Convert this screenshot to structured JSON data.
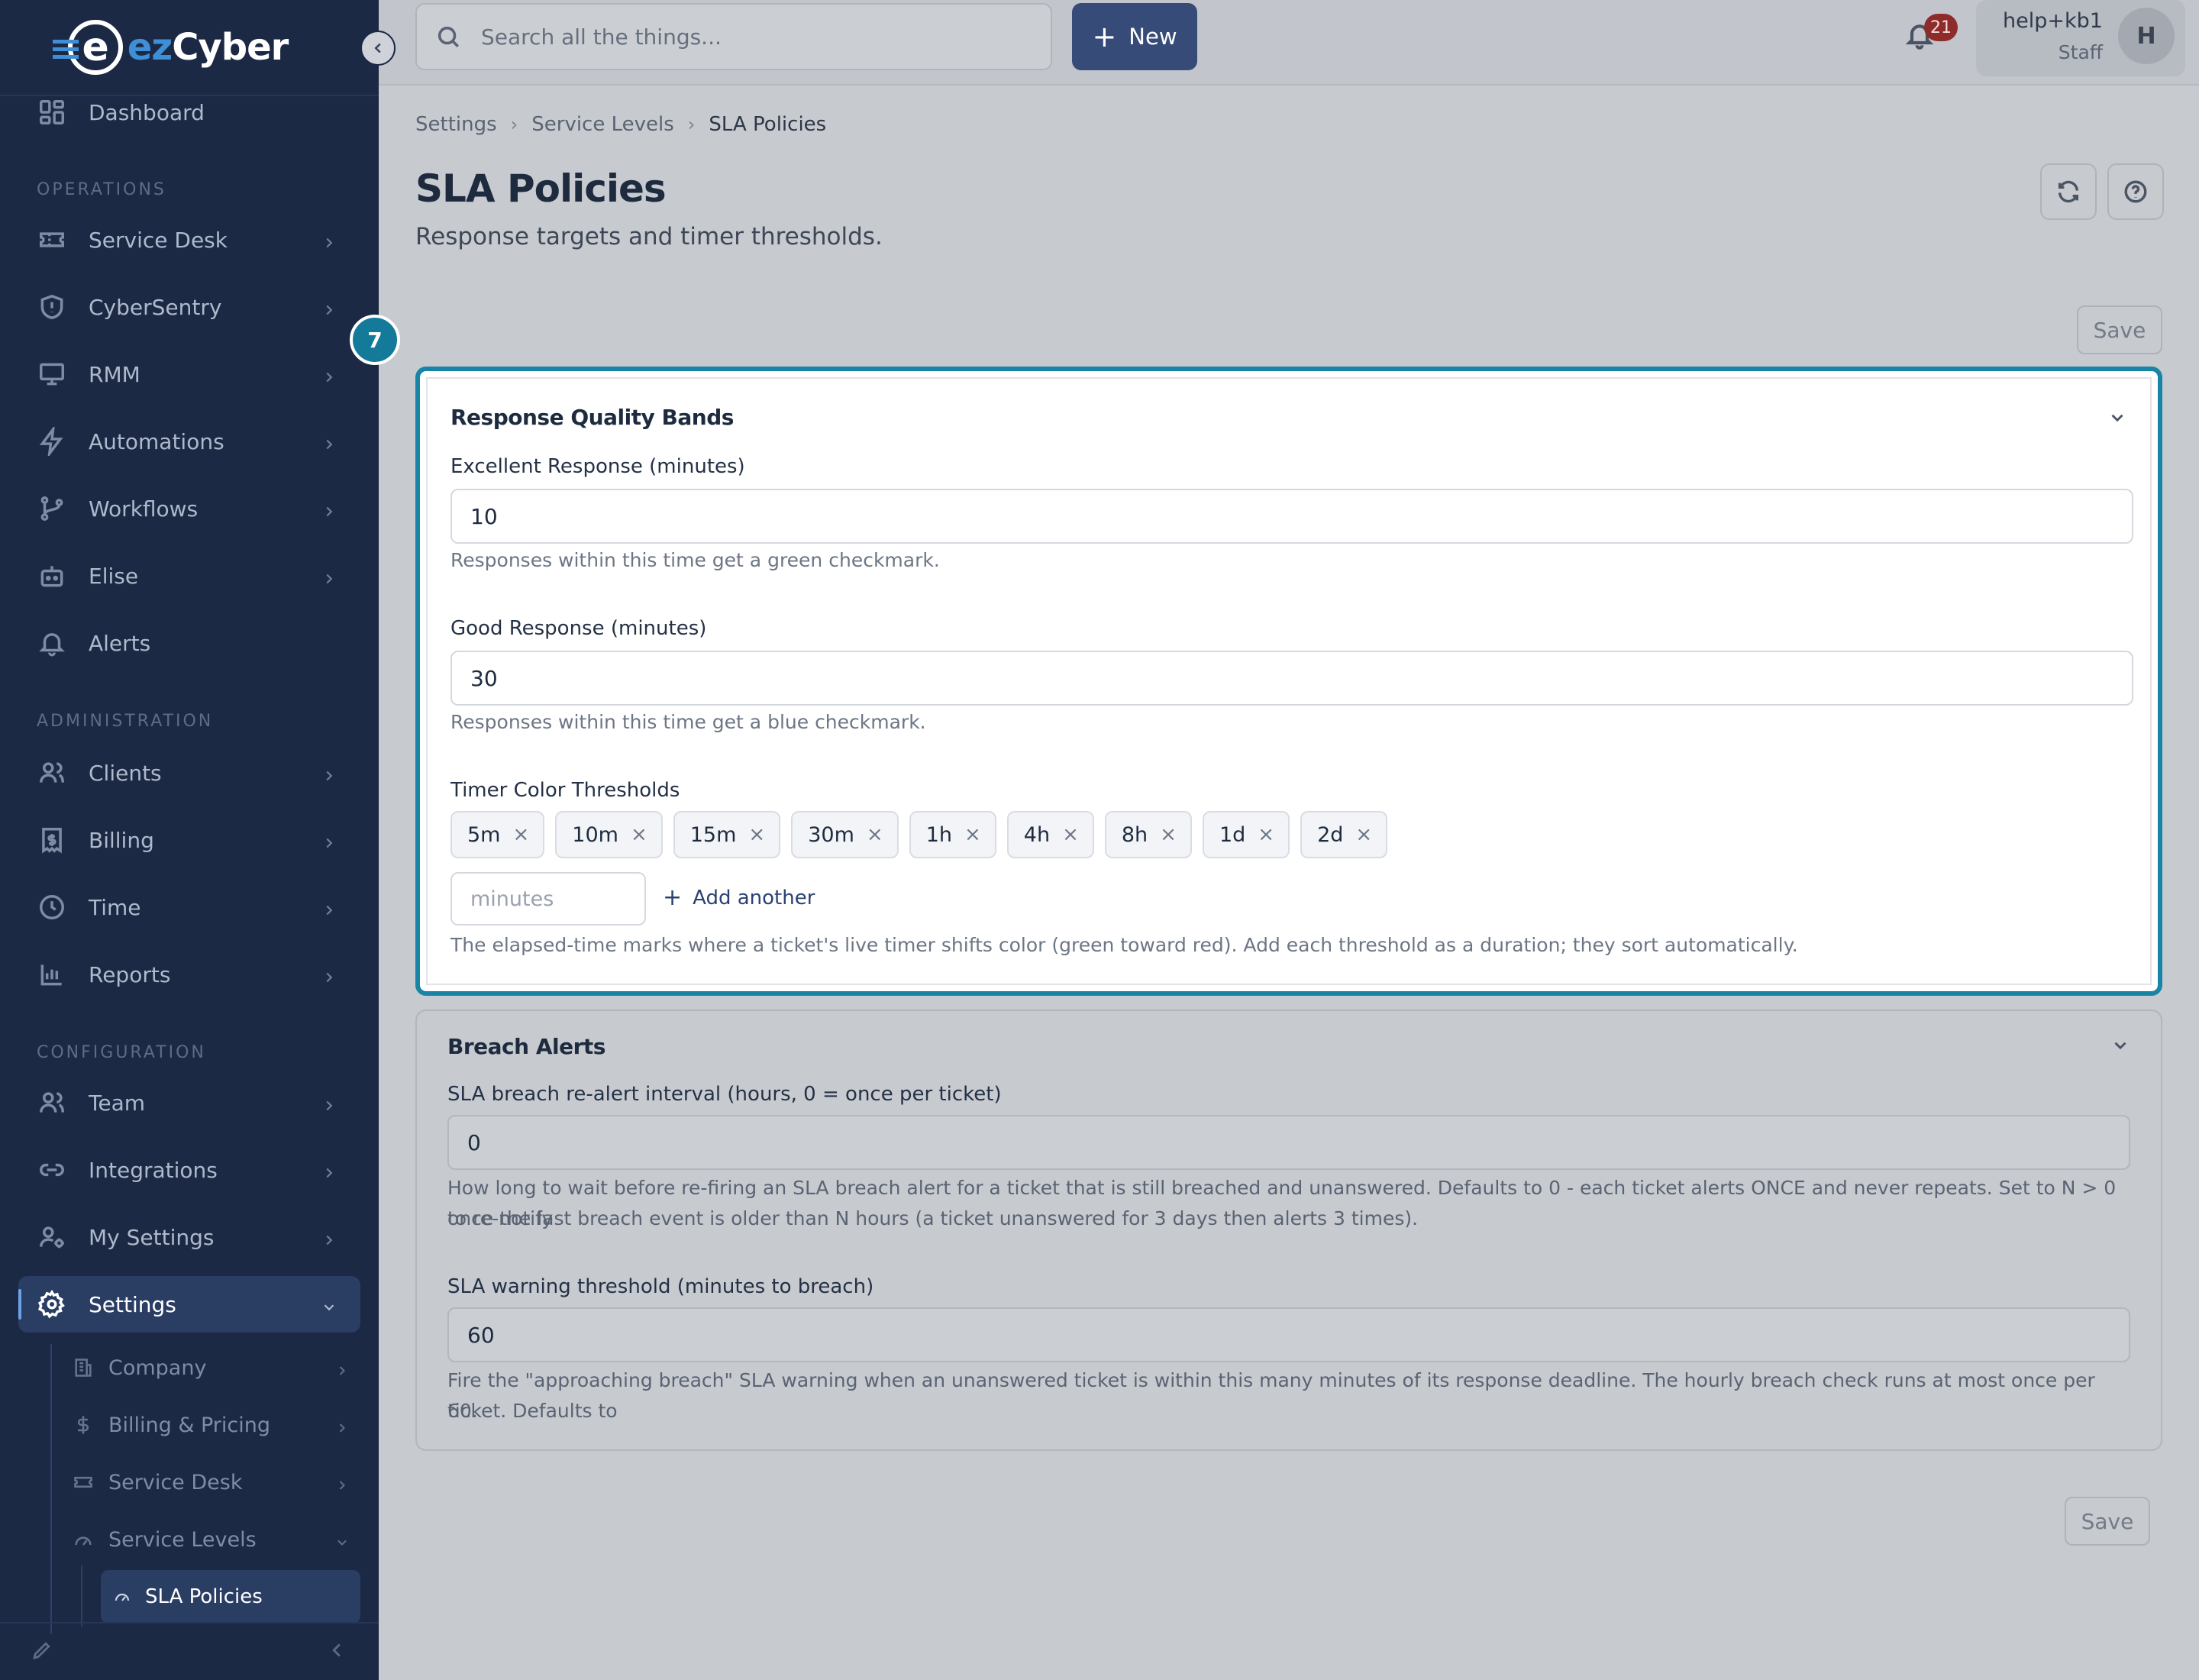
{
  "brand": {
    "logo_prefix": "ez",
    "logo_text": "Cyber",
    "logo_mark": "e"
  },
  "sidebar": {
    "dashboard": "Dashboard",
    "sections": {
      "operations": "OPERATIONS",
      "administration": "ADMINISTRATION",
      "configuration": "CONFIGURATION"
    },
    "operations": [
      "Service Desk",
      "CyberSentry",
      "RMM",
      "Automations",
      "Workflows",
      "Elise",
      "Alerts"
    ],
    "administration": [
      "Clients",
      "Billing",
      "Time",
      "Reports"
    ],
    "configuration": [
      "Team",
      "Integrations",
      "My Settings",
      "Settings"
    ],
    "settings_children": [
      "Company",
      "Billing & Pricing",
      "Service Desk",
      "Service Levels"
    ],
    "active_leaf": "SLA Policies"
  },
  "topbar": {
    "search_placeholder": "Search all the things...",
    "new_label": "New",
    "notification_count": "21",
    "user_name": "help+kb1",
    "user_role": "Staff",
    "avatar_initial": "H"
  },
  "breadcrumb": [
    "Settings",
    "Service Levels",
    "SLA Policies"
  ],
  "page": {
    "title": "SLA Policies",
    "subtitle": "Response targets and timer thresholds.",
    "save_label": "Save",
    "step_number": "7"
  },
  "quality_bands": {
    "title": "Response Quality Bands",
    "excellent": {
      "label": "Excellent Response (minutes)",
      "value": "10",
      "help": "Responses within this time get a green checkmark."
    },
    "good": {
      "label": "Good Response (minutes)",
      "value": "30",
      "help": "Responses within this time get a blue checkmark."
    },
    "thresholds": {
      "label": "Timer Color Thresholds",
      "chips": [
        "5m",
        "10m",
        "15m",
        "30m",
        "1h",
        "4h",
        "8h",
        "1d",
        "2d"
      ],
      "input_placeholder": "minutes",
      "add_label": "Add another",
      "help": "The elapsed-time marks where a ticket's live timer shifts color (green toward red). Add each threshold as a duration; they sort automatically."
    }
  },
  "breach_alerts": {
    "title": "Breach Alerts",
    "realert": {
      "label": "SLA breach re-alert interval (hours, 0 = once per ticket)",
      "value": "0",
      "help_line1": "How long to wait before re-firing an SLA breach alert for a ticket that is still breached and unanswered. Defaults to 0 - each ticket alerts ONCE and never repeats. Set to N > 0 to re-notify",
      "help_line2": "once the last breach event is older than N hours (a ticket unanswered for 3 days then alerts 3 times)."
    },
    "warning": {
      "label": "SLA warning threshold (minutes to breach)",
      "value": "60",
      "help_line1": "Fire the \"approaching breach\" SLA warning when an unanswered ticket is within this many minutes of its response deadline. The hourly breach check runs at most once per ticket. Defaults to",
      "help_line2": "60."
    }
  },
  "colors": {
    "sidebar_bg": "#1b2945",
    "accent": "#374b78",
    "highlight": "#1884a6",
    "badge": "#8e2b2b"
  }
}
